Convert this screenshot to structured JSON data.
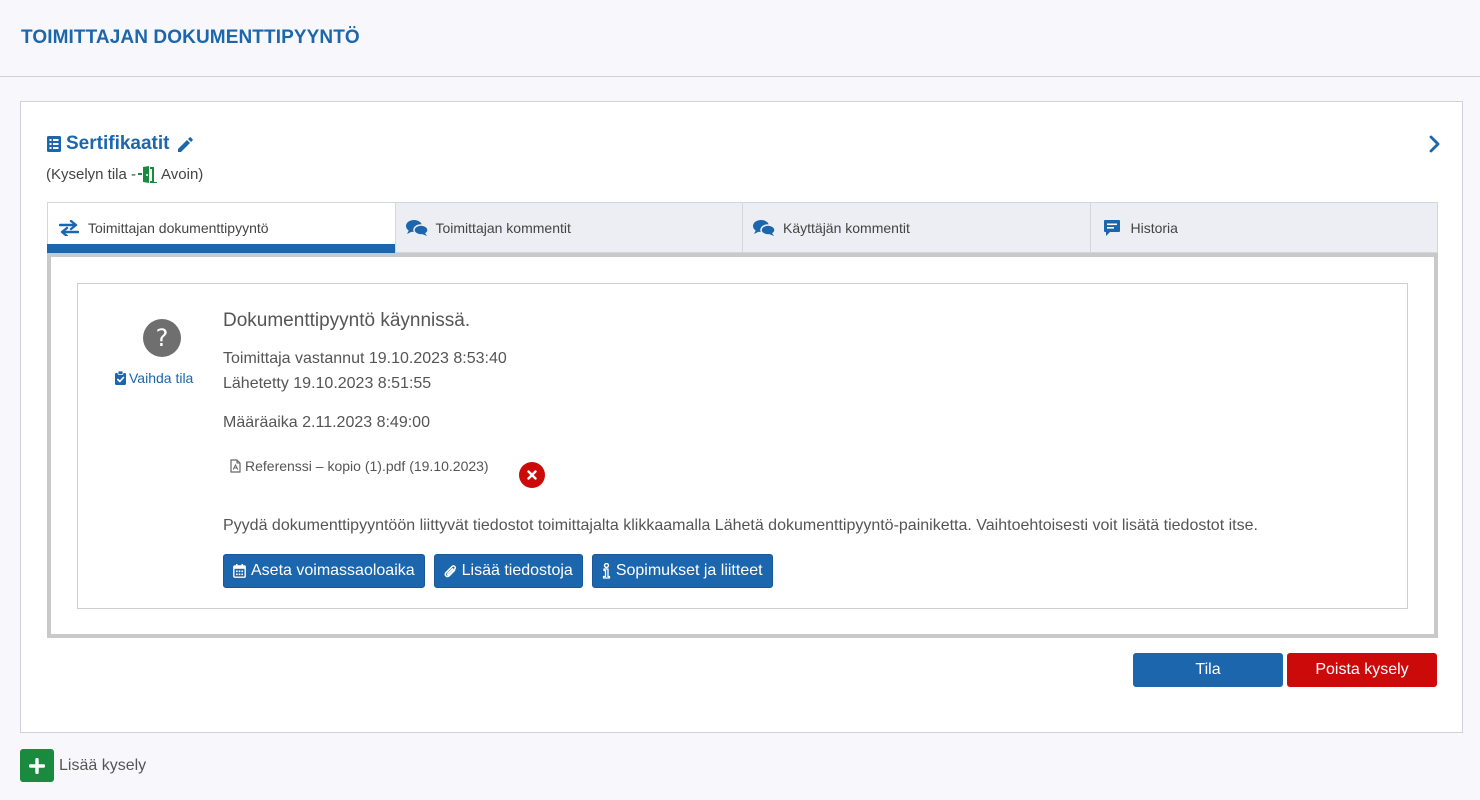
{
  "page": {
    "title": "TOIMITTAJAN DOKUMENTTIPYYNTÖ"
  },
  "survey": {
    "title": "Sertifikaatit",
    "status_prefix": "(Kyselyn tila -",
    "status_value": "Avoin)",
    "title_icon": "list-icon",
    "edit_icon": "pencil-icon",
    "expand_icon": "chevron-right-icon"
  },
  "tabs": [
    {
      "label": "Toimittajan dokumenttipyyntö",
      "icon": "exchange-arrows-icon",
      "active": true
    },
    {
      "label": "Toimittajan kommentit",
      "icon": "comments-icon",
      "active": false
    },
    {
      "label": "Käyttäjän kommentit",
      "icon": "comments-icon",
      "active": false
    },
    {
      "label": "Historia",
      "icon": "message-icon",
      "active": false
    }
  ],
  "request": {
    "state_glyph": "?",
    "change_state_label": "Vaihda tila",
    "headline": "Dokumenttipyyntö käynnissä.",
    "responded": "Toimittaja vastannut 19.10.2023 8:53:40",
    "sent": "Lähetetty 19.10.2023 8:51:55",
    "deadline": "Määräaika 2.11.2023 8:49:00",
    "file_label": "Referenssi – kopio (1).pdf (19.10.2023)",
    "info_text": "Pyydä dokumenttipyyntöön liittyvät tiedostot toimittajalta klikkaamalla Lähetä dokumenttipyyntö-painiketta. Vaihtoehtoisesti voit lisätä tiedostot itse.",
    "buttons": {
      "set_validity": "Aseta voimassaoloaika",
      "add_files": "Lisää tiedostoja",
      "contracts": "Sopimukset ja liitteet"
    }
  },
  "footer_buttons": {
    "state": "Tila",
    "delete": "Poista kysely"
  },
  "add_survey": {
    "label": "Lisää kysely"
  },
  "colors": {
    "primary": "#1c66ae",
    "danger": "#cc0a0a",
    "success": "#1a8a3e",
    "tab_bg": "#eceef3"
  }
}
